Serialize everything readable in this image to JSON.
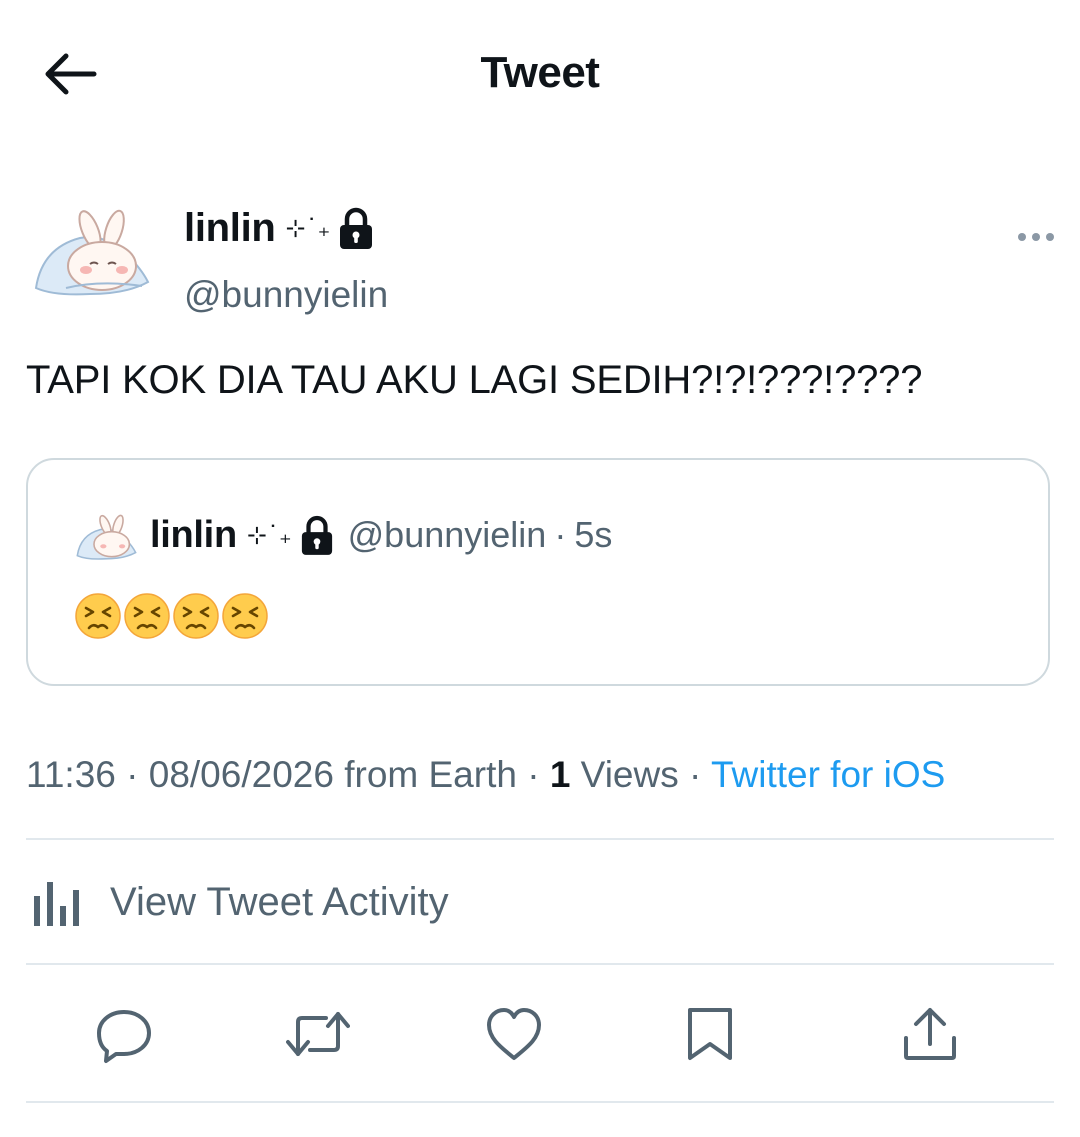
{
  "header": {
    "title": "Tweet",
    "back_icon": "arrow-left-icon"
  },
  "tweet": {
    "author": {
      "name": "linlin",
      "name_decoration": "⊹˙₊",
      "verified_icon": "lock-icon",
      "handle": "@bunnyielin",
      "avatar": "bunny-avatar"
    },
    "text": "TAPI KOK DIA TAU AKU LAGI SEDIH?!?!???!????",
    "quoted": {
      "name": "linlin",
      "name_decoration": "⊹˙₊",
      "handle": "@bunnyielin",
      "separator": "·",
      "time": "5s",
      "emojis": [
        "persevering-face",
        "persevering-face",
        "persevering-face",
        "persevering-face"
      ]
    },
    "meta": {
      "time": "11:36",
      "sep1": " · ",
      "date": "08/06/2026",
      "location": " from Earth",
      "sep2": " · ",
      "views_count": "1",
      "views_label": " Views",
      "sep3": " · ",
      "source": "Twitter for iOS"
    }
  },
  "activity": {
    "label": "View Tweet Activity",
    "icon": "bar-chart-icon"
  },
  "actions": [
    "reply-icon",
    "retweet-icon",
    "like-icon",
    "bookmark-icon",
    "share-icon"
  ],
  "colors": {
    "text": "#0f1419",
    "secondary": "#536471",
    "accent": "#1d9bf0",
    "border": "#cfd9de",
    "divider": "#e1e8ed",
    "emoji": "#ffcc4d"
  }
}
